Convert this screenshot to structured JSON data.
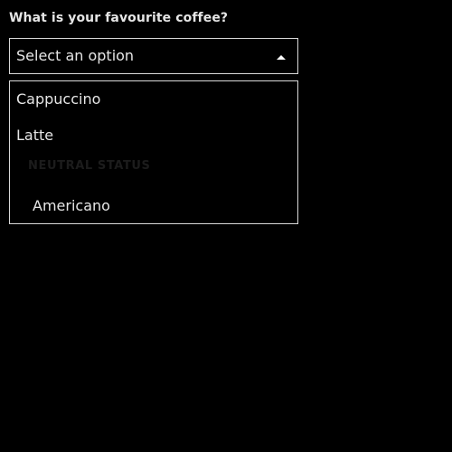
{
  "form": {
    "question": "What is your favourite coffee?",
    "select": {
      "value": "Select an option",
      "expanded": true,
      "caret_icon": "caret-up-icon"
    },
    "options": [
      {
        "label": "Cappuccino"
      },
      {
        "label": "Latte"
      }
    ],
    "group": {
      "label": "NEUTRAL STATUS",
      "options": [
        {
          "label": "Americano"
        }
      ]
    }
  },
  "colors": {
    "background": "#000000",
    "text": "#e6e6e6",
    "border": "#d9d9d9",
    "group_label": "#1c1c1c"
  }
}
